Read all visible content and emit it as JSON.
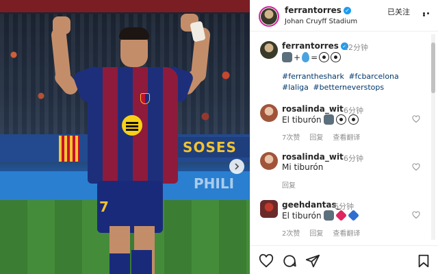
{
  "post": {
    "username": "ferrantorres",
    "location": "Johan Cruyff Stadium",
    "follow_label": "已关注",
    "caption": {
      "time": "12分钟",
      "line1_symbols": [
        "shark-emoji",
        "+",
        "drop-emoji",
        "=",
        "soccer-ball-emoji",
        "soccer-ball-emoji"
      ],
      "hashtags": [
        "#ferrantheshark",
        "#fcbarcelona",
        "#laliga",
        "#betterneverstops"
      ]
    }
  },
  "photo": {
    "board_text_1": "SOSES",
    "board_text_2": "PHILI",
    "shirt_number": "7"
  },
  "comments": [
    {
      "username": "rosalinda_wit",
      "time": "6分钟",
      "text": "El tiburón",
      "emojis": [
        "shark-emoji",
        "soccer-ball-emoji",
        "soccer-ball-emoji"
      ],
      "likes": "7次赞",
      "reply": "回复",
      "translate": "查看翻译"
    },
    {
      "username": "rosalinda_wit",
      "time": "6分钟",
      "text": "Mi tiburón",
      "emojis": [],
      "likes": "",
      "reply": "回复",
      "translate": ""
    },
    {
      "username": "geehdantas_",
      "time": "6分钟",
      "text": "El tiburón",
      "emojis": [
        "shark-emoji",
        "red-heart-emoji",
        "blue-heart-emoji"
      ],
      "likes": "2次赞",
      "reply": "回复",
      "translate": "查看翻译"
    }
  ],
  "icons": {
    "like": "heart-icon",
    "comment": "comment-icon",
    "share": "share-icon",
    "save": "bookmark-icon"
  },
  "colors": {
    "link": "#00376b",
    "muted": "#8e8e8e",
    "verified": "#1d9bf0"
  }
}
